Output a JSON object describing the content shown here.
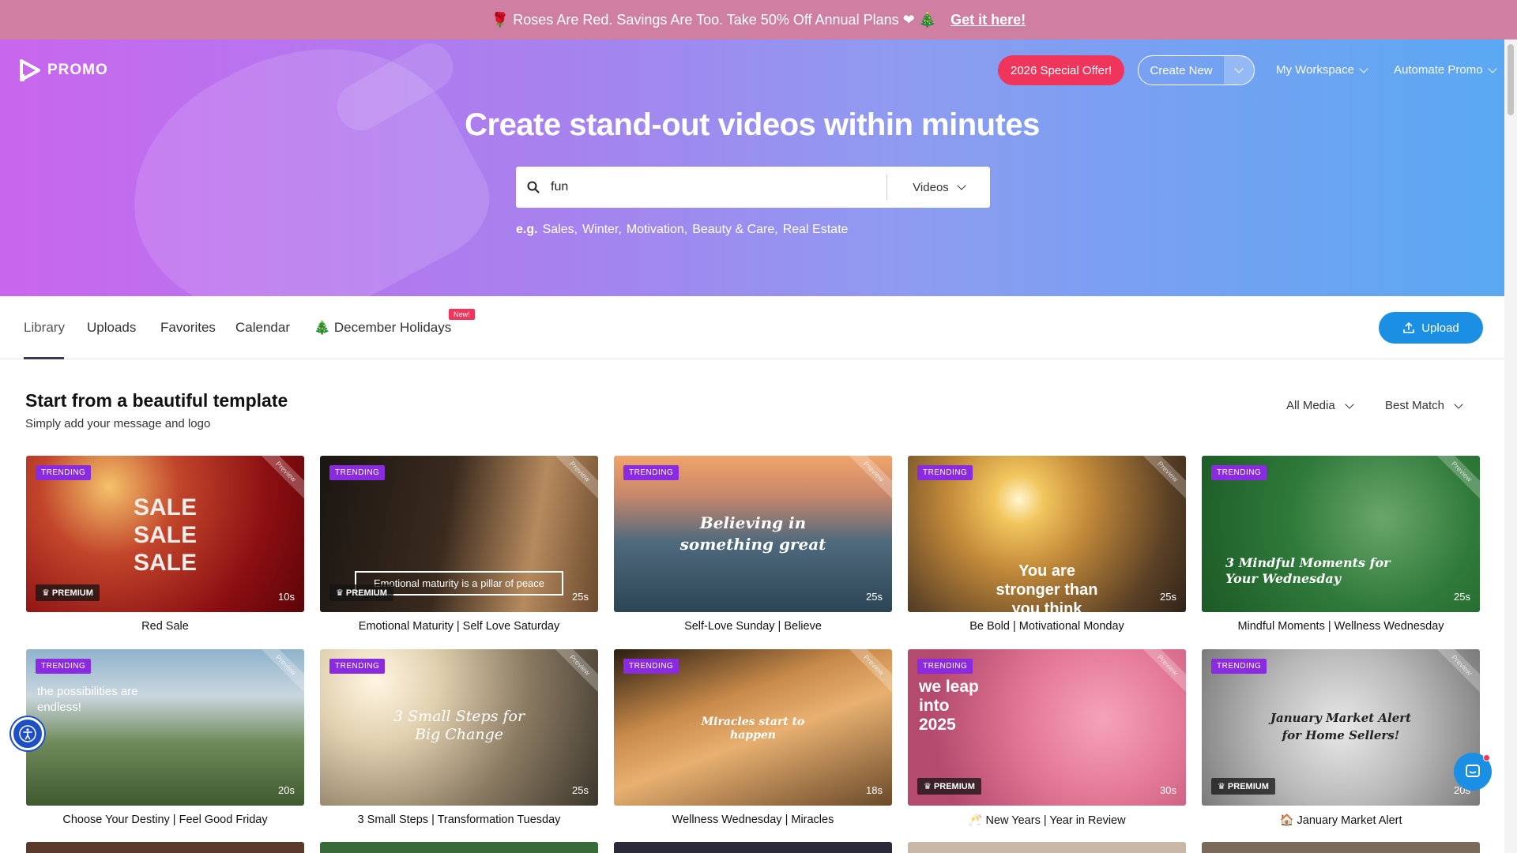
{
  "banner": {
    "text": "🌹 Roses Are Red. Savings Are Too. Take 50% Off Annual Plans ❤ 🎄",
    "link": "Get it here!"
  },
  "header": {
    "logo": "PROMO",
    "special_offer": "2026 Special Offer!",
    "create_new": "Create New",
    "my_workspace": "My Workspace",
    "automate_promo": "Automate Promo"
  },
  "hero": {
    "title": "Create stand-out videos within minutes",
    "search_value": "fun",
    "search_type": "Videos",
    "eg_label": "e.g.",
    "examples": [
      "Sales,",
      "Winter,",
      "Motivation,",
      "Beauty & Care,",
      "Real Estate"
    ]
  },
  "tabs": {
    "items": [
      "Library",
      "Uploads",
      "Favorites",
      "Calendar",
      "🎄 December Holidays"
    ],
    "new_badge": "New!",
    "upload": "Upload"
  },
  "section": {
    "title": "Start from a beautiful template",
    "subtitle": "Simply add your message and logo",
    "filter_media": "All Media",
    "filter_sort": "Best Match"
  },
  "labels": {
    "trending": "TRENDING",
    "premium": "PREMIUM",
    "preview": "Preview"
  },
  "cards": [
    {
      "title": "Red Sale",
      "duration": "10s",
      "premium": true,
      "overlay": "SALE\nSALE\nSALE"
    },
    {
      "title": "Emotional Maturity | Self Love Saturday",
      "duration": "25s",
      "premium": true,
      "overlay": "Emotional maturity is a pillar of peace"
    },
    {
      "title": "Self-Love Sunday | Believe",
      "duration": "25s",
      "premium": false,
      "overlay": "Believing in something great"
    },
    {
      "title": "Be Bold | Motivational Monday",
      "duration": "25s",
      "premium": false,
      "overlay": "You are stronger than you think"
    },
    {
      "title": "Mindful Moments | Wellness Wednesday",
      "duration": "25s",
      "premium": false,
      "overlay": "3 Mindful Moments for Your Wednesday"
    },
    {
      "title": "Choose Your Destiny | Feel Good Friday",
      "duration": "20s",
      "premium": false,
      "overlay": "the possibilities are endless!"
    },
    {
      "title": "3 Small Steps | Transformation Tuesday",
      "duration": "25s",
      "premium": false,
      "overlay": "3 Small Steps for Big Change"
    },
    {
      "title": "Wellness Wednesday | Miracles",
      "duration": "18s",
      "premium": false,
      "overlay": "Miracles start to happen"
    },
    {
      "title": "🥂 New Years | Year in Review",
      "duration": "30s",
      "premium": true,
      "overlay": "we leap into 2025"
    },
    {
      "title": "🏠 January Market Alert",
      "duration": "20s",
      "premium": true,
      "overlay": "January Market Alert for Home Sellers!"
    }
  ]
}
